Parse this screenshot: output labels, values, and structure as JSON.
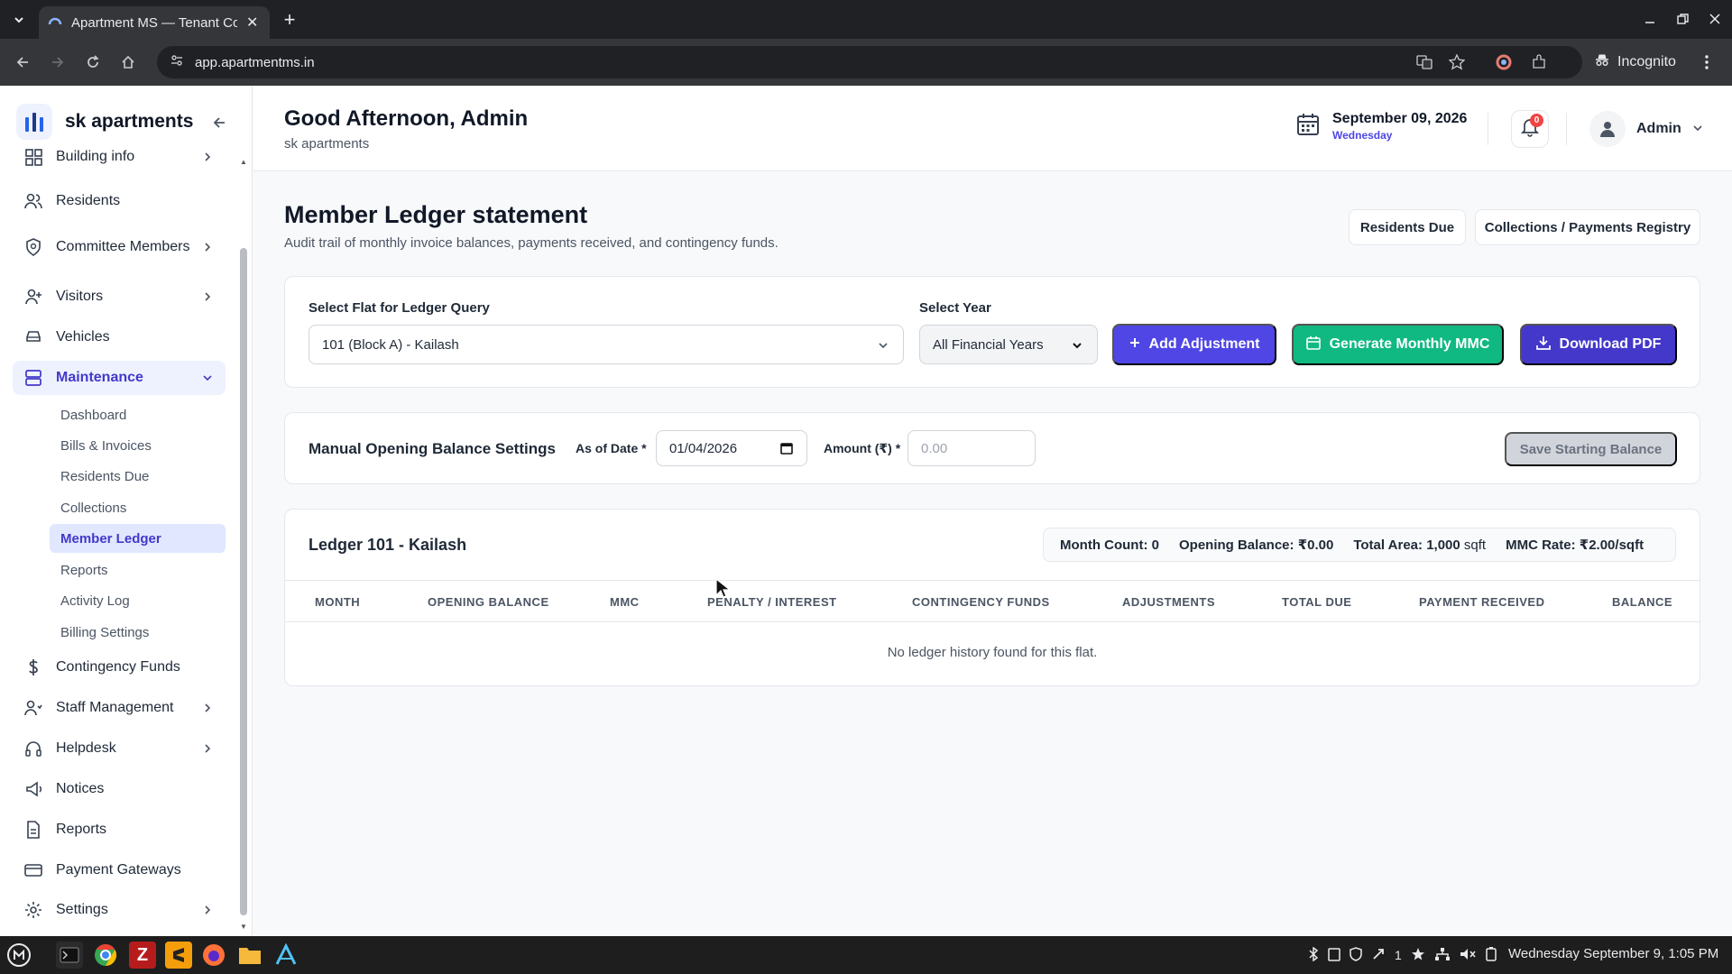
{
  "browser": {
    "tab_title": "Apartment MS — Tenant Console",
    "url": "app.apartmentms.in",
    "profile_label": "Incognito"
  },
  "sidebar": {
    "brand": "sk apartments",
    "items": [
      {
        "label": "Building info",
        "icon": "building-icon",
        "has_chevron": true
      },
      {
        "label": "Residents",
        "icon": "users-icon"
      },
      {
        "label": "Committee Members",
        "icon": "shield-icon",
        "has_chevron": true
      },
      {
        "label": "Visitors",
        "icon": "user-plus-icon",
        "has_chevron": true
      },
      {
        "label": "Vehicles",
        "icon": "car-icon"
      },
      {
        "label": "Maintenance",
        "icon": "server-icon",
        "has_chevron": true,
        "expanded": true
      },
      {
        "label": "Contingency Funds",
        "icon": "dollar-icon"
      },
      {
        "label": "Staff Management",
        "icon": "staff-icon",
        "has_chevron": true
      },
      {
        "label": "Helpdesk",
        "icon": "headphones-icon",
        "has_chevron": true
      },
      {
        "label": "Notices",
        "icon": "megaphone-icon"
      },
      {
        "label": "Reports",
        "icon": "file-icon"
      },
      {
        "label": "Payment Gateways",
        "icon": "credit-card-icon"
      },
      {
        "label": "Settings",
        "icon": "gear-icon",
        "has_chevron": true
      }
    ],
    "maintenance_sub": [
      "Dashboard",
      "Bills & Invoices",
      "Residents Due",
      "Collections",
      "Member Ledger",
      "Reports",
      "Activity Log",
      "Billing Settings"
    ],
    "active_sub": "Member Ledger"
  },
  "header": {
    "greeting": "Good Afternoon, Admin",
    "society": "sk apartments",
    "date": "September 09, 2026",
    "weekday": "Wednesday",
    "notif_count": "0",
    "user": "Admin"
  },
  "page": {
    "title": "Member Ledger statement",
    "subtitle": "Audit trail of monthly invoice balances, payments received, and contingency funds.",
    "btn_residents_due": "Residents Due",
    "btn_collections": "Collections / Payments Registry"
  },
  "query": {
    "flat_label": "Select Flat for Ledger Query",
    "flat_value": "101 (Block A) - Kailash",
    "year_label": "Select Year",
    "year_value": "All Financial Years",
    "btn_add_adjustment": "Add Adjustment",
    "btn_generate_mmc": "Generate Monthly MMC",
    "btn_download_pdf": "Download PDF"
  },
  "opening": {
    "title": "Manual Opening Balance Settings",
    "date_label": "As of Date *",
    "date_value": "01/04/2026",
    "amount_label": "Amount (₹) *",
    "amount_placeholder": "0.00",
    "btn_save": "Save Starting Balance"
  },
  "ledger": {
    "title": "Ledger 101 - Kailash",
    "month_count_label": "Month Count:",
    "month_count": "0",
    "opening_label": "Opening Balance:",
    "opening_value": "₹0.00",
    "area_label": "Total Area:",
    "area_value": "1,000",
    "area_unit": "sqft",
    "rate_label": "MMC Rate:",
    "rate_value": "₹2.00/sqft",
    "columns": [
      "MONTH",
      "OPENING BALANCE",
      "MMC",
      "PENALTY / INTEREST",
      "CONTINGENCY FUNDS",
      "ADJUSTMENTS",
      "TOTAL DUE",
      "PAYMENT RECEIVED",
      "BALANCE"
    ],
    "empty": "No ledger history found for this flat."
  },
  "taskbar": {
    "clock": "Wednesday September 9, 1:05 PM",
    "tray_count": "1"
  },
  "colors": {
    "accent": "#4f46e5",
    "green": "#10b981",
    "indigo_dark": "#4338ca"
  }
}
